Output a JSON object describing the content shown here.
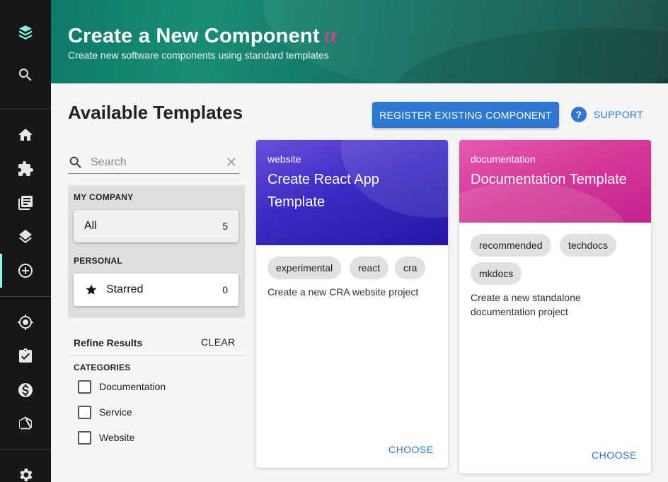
{
  "sidebar": {
    "items": [
      {
        "icon": "backstage-logo-icon"
      },
      {
        "icon": "search-icon"
      },
      {
        "icon": "home-icon"
      },
      {
        "icon": "extension-icon"
      },
      {
        "icon": "library-books-icon"
      },
      {
        "icon": "layers-icon"
      },
      {
        "icon": "create-component-icon",
        "active": true
      },
      {
        "icon": "gps-target-icon"
      },
      {
        "icon": "assignment-turned-in-icon"
      },
      {
        "icon": "cost-insights-icon"
      },
      {
        "icon": "graphiql-icon"
      },
      {
        "icon": "settings-icon"
      }
    ],
    "accent_color": "#9bf0e1"
  },
  "header": {
    "title": "Create a New Component",
    "alpha_symbol": "α",
    "subtitle": "Create new software components using standard templates"
  },
  "content": {
    "title": "Available Templates",
    "register_button": "REGISTER EXISTING COMPONENT",
    "support_label": "SUPPORT",
    "support_icon_glyph": "?"
  },
  "search": {
    "placeholder": "Search",
    "value": ""
  },
  "filters": {
    "groups": [
      {
        "heading": "MY COMPANY",
        "items": [
          {
            "label": "All",
            "count": "5"
          }
        ]
      },
      {
        "heading": "PERSONAL",
        "items": [
          {
            "label": "Starred",
            "count": "0",
            "icon": "star-icon"
          }
        ]
      }
    ]
  },
  "refine": {
    "title": "Refine Results",
    "clear_label": "CLEAR",
    "categories_heading": "CATEGORIES",
    "categories": [
      {
        "label": "Documentation",
        "checked": false
      },
      {
        "label": "Service",
        "checked": false
      },
      {
        "label": "Website",
        "checked": false
      }
    ]
  },
  "cards": [
    {
      "type": "website",
      "name_lines": [
        "Create React App",
        "Template"
      ],
      "tags": [
        "experimental",
        "react",
        "cra"
      ],
      "description_lines": [
        "Create a new CRA website project"
      ],
      "action": "CHOOSE",
      "header_colors": [
        "#5a3fd6",
        "#2a1fb0"
      ]
    },
    {
      "type": "documentation",
      "name_lines": [
        "Documentation Template"
      ],
      "tags": [
        "recommended",
        "techdocs",
        "mkdocs"
      ],
      "description_lines": [
        "Create a new standalone",
        "documentation project"
      ],
      "action": "CHOOSE",
      "header_colors": [
        "#e04ca8",
        "#c2238d"
      ]
    }
  ],
  "colors": {
    "primary": "#2e77d0",
    "header_green": "#127062",
    "alpha": "#e5398c"
  }
}
